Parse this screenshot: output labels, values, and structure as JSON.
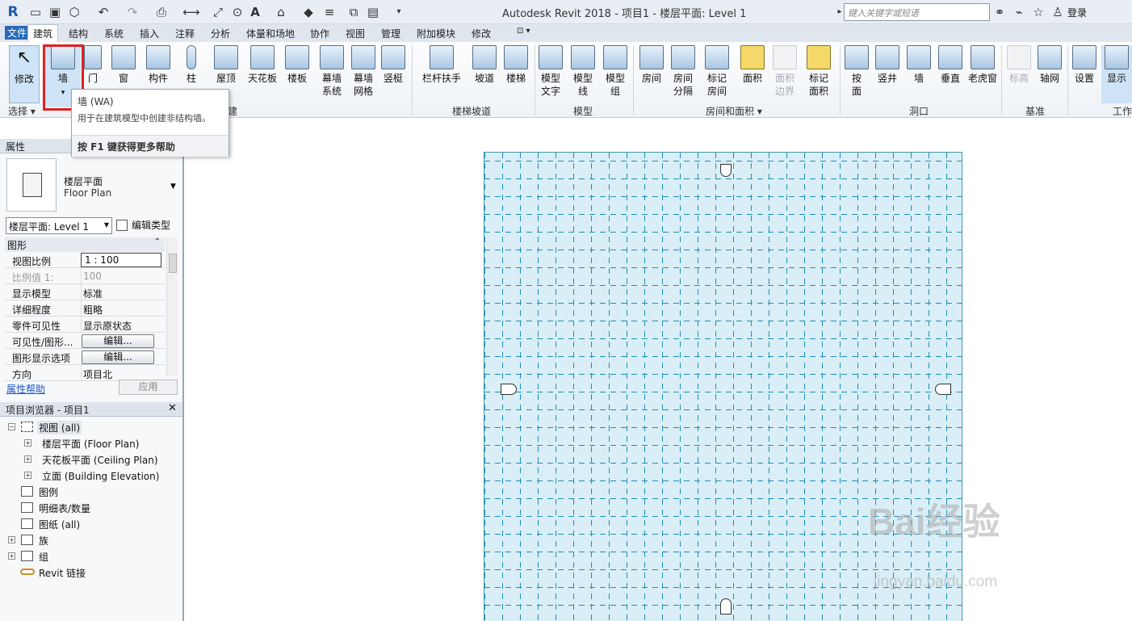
{
  "titlebar": {
    "app_title": "Autodesk Revit 2018 -     项目1 - 楼层平面: Level 1",
    "logo": "R",
    "search_placeholder": "键入关键字或短语",
    "login_label": "登录"
  },
  "menu_tabs": [
    "文件",
    "建筑",
    "结构",
    "系统",
    "插入",
    "注释",
    "分析",
    "体量和场地",
    "协作",
    "视图",
    "管理",
    "附加模块",
    "修改"
  ],
  "active_tab": "建筑",
  "ribbon": {
    "buttons": [
      {
        "label": "修改",
        "icon": "cursor-icon"
      },
      {
        "label": "墙",
        "icon": "wall-icon"
      },
      {
        "label": "门",
        "icon": "door-icon"
      },
      {
        "label": "窗",
        "icon": "window-icon"
      },
      {
        "label": "构件",
        "icon": "component-icon"
      },
      {
        "label": "柱",
        "icon": "column-icon"
      },
      {
        "label": "屋顶",
        "icon": "roof-icon"
      },
      {
        "label": "天花板",
        "icon": "ceiling-icon"
      },
      {
        "label": "楼板",
        "icon": "floor-icon"
      },
      {
        "label": "幕墙\n系统",
        "icon": "curtain-system-icon"
      },
      {
        "label": "幕墙\n网格",
        "icon": "curtain-grid-icon"
      },
      {
        "label": "竖梃",
        "icon": "mullion-icon"
      },
      {
        "label": "栏杆扶手",
        "icon": "railing-icon"
      },
      {
        "label": "坡道",
        "icon": "ramp-icon"
      },
      {
        "label": "楼梯",
        "icon": "stair-icon"
      },
      {
        "label": "模型\n文字",
        "icon": "model-text-icon"
      },
      {
        "label": "模型\n线",
        "icon": "model-line-icon"
      },
      {
        "label": "模型\n组",
        "icon": "model-group-icon"
      },
      {
        "label": "房间",
        "icon": "room-icon"
      },
      {
        "label": "房间\n分隔",
        "icon": "room-separator-icon"
      },
      {
        "label": "标记\n房间",
        "icon": "tag-room-icon"
      },
      {
        "label": "面积",
        "icon": "area-icon"
      },
      {
        "label": "面积\n边界",
        "icon": "area-boundary-icon"
      },
      {
        "label": "标记\n面积",
        "icon": "tag-area-icon"
      },
      {
        "label": "按\n面",
        "icon": "by-face-icon"
      },
      {
        "label": "竖井",
        "icon": "shaft-icon"
      },
      {
        "label": "墙",
        "icon": "wall-opening-icon"
      },
      {
        "label": "垂直",
        "icon": "vertical-opening-icon"
      },
      {
        "label": "老虎窗",
        "icon": "dormer-icon"
      },
      {
        "label": "标高",
        "icon": "level-icon"
      },
      {
        "label": "轴网",
        "icon": "grid-icon"
      },
      {
        "label": "设置",
        "icon": "set-icon"
      },
      {
        "label": "显示",
        "icon": "show-icon"
      }
    ],
    "groups": {
      "select": "选择",
      "build_partial": "建",
      "circulation": "楼梯坡道",
      "model": "模型",
      "room_area": "房间和面积",
      "opening": "洞口",
      "datum": "基准",
      "workplane_partial": "工作"
    }
  },
  "tooltip": {
    "title": "墙 (WA)",
    "description": "用于在建筑模型中创建非结构墙。",
    "help": "按 F1 键获得更多帮助"
  },
  "properties": {
    "header": "属性",
    "type_cn": "楼层平面",
    "type_en": "Floor Plan",
    "view_selector": "楼层平面: Level 1",
    "edit_type": "编辑类型",
    "section": "图形",
    "rows": [
      {
        "name": "视图比例",
        "value": "1 : 100"
      },
      {
        "name": "比例值 1:",
        "value": "100"
      },
      {
        "name": "显示模型",
        "value": "标准"
      },
      {
        "name": "详细程度",
        "value": "粗略"
      },
      {
        "name": "零件可见性",
        "value": "显示原状态"
      },
      {
        "name": "可见性/图形...",
        "value": "编辑..."
      },
      {
        "name": "图形显示选项",
        "value": "编辑..."
      },
      {
        "name": "方向",
        "value": "项目北"
      }
    ],
    "help_link": "属性帮助",
    "apply": "应用"
  },
  "browser": {
    "header": "项目浏览器 - 项目1",
    "close": "✕",
    "nodes": [
      {
        "label": "视图 (all)"
      },
      {
        "label": "楼层平面 (Floor Plan)"
      },
      {
        "label": "天花板平面 (Ceiling Plan)"
      },
      {
        "label": "立面 (Building Elevation)"
      },
      {
        "label": "图例"
      },
      {
        "label": "明细表/数量"
      },
      {
        "label": "图纸 (all)"
      },
      {
        "label": "族"
      },
      {
        "label": "组"
      },
      {
        "label": "Revit 链接"
      }
    ]
  },
  "watermark": {
    "text": "Bai经验",
    "url": "jingyan.baidu.com"
  },
  "colors": {
    "sheet_bg": "#d9eef6",
    "grid_line": "#1f8fb8",
    "highlight": "#e02020",
    "accent": "#1a56c9"
  }
}
